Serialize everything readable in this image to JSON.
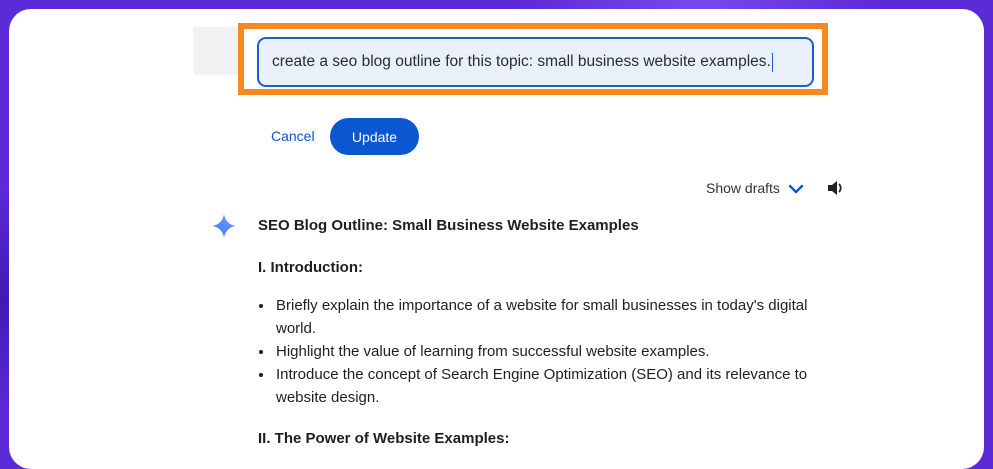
{
  "edit": {
    "value": "create a seo blog outline for this topic: small business website examples."
  },
  "actions": {
    "cancel_label": "Cancel",
    "update_label": "Update"
  },
  "drafts": {
    "label": "Show drafts"
  },
  "response": {
    "title": "SEO Blog Outline: Small Business Website Examples",
    "section1": "I. Introduction:",
    "bullets": [
      "Briefly explain the importance of a website for small businesses in today's digital world.",
      "Highlight the value of learning from successful website examples.",
      "Introduce the concept of Search Engine Optimization (SEO) and its relevance to website design."
    ],
    "section2": "II. The Power of Website Examples:"
  },
  "colors": {
    "background": "#5b2bd6",
    "highlight": "#f6891f",
    "accent": "#0b57d0"
  },
  "icons": {
    "drafts_toggle": "chevron-down-icon",
    "read_aloud": "speaker-icon",
    "assistant": "sparkle-icon"
  }
}
